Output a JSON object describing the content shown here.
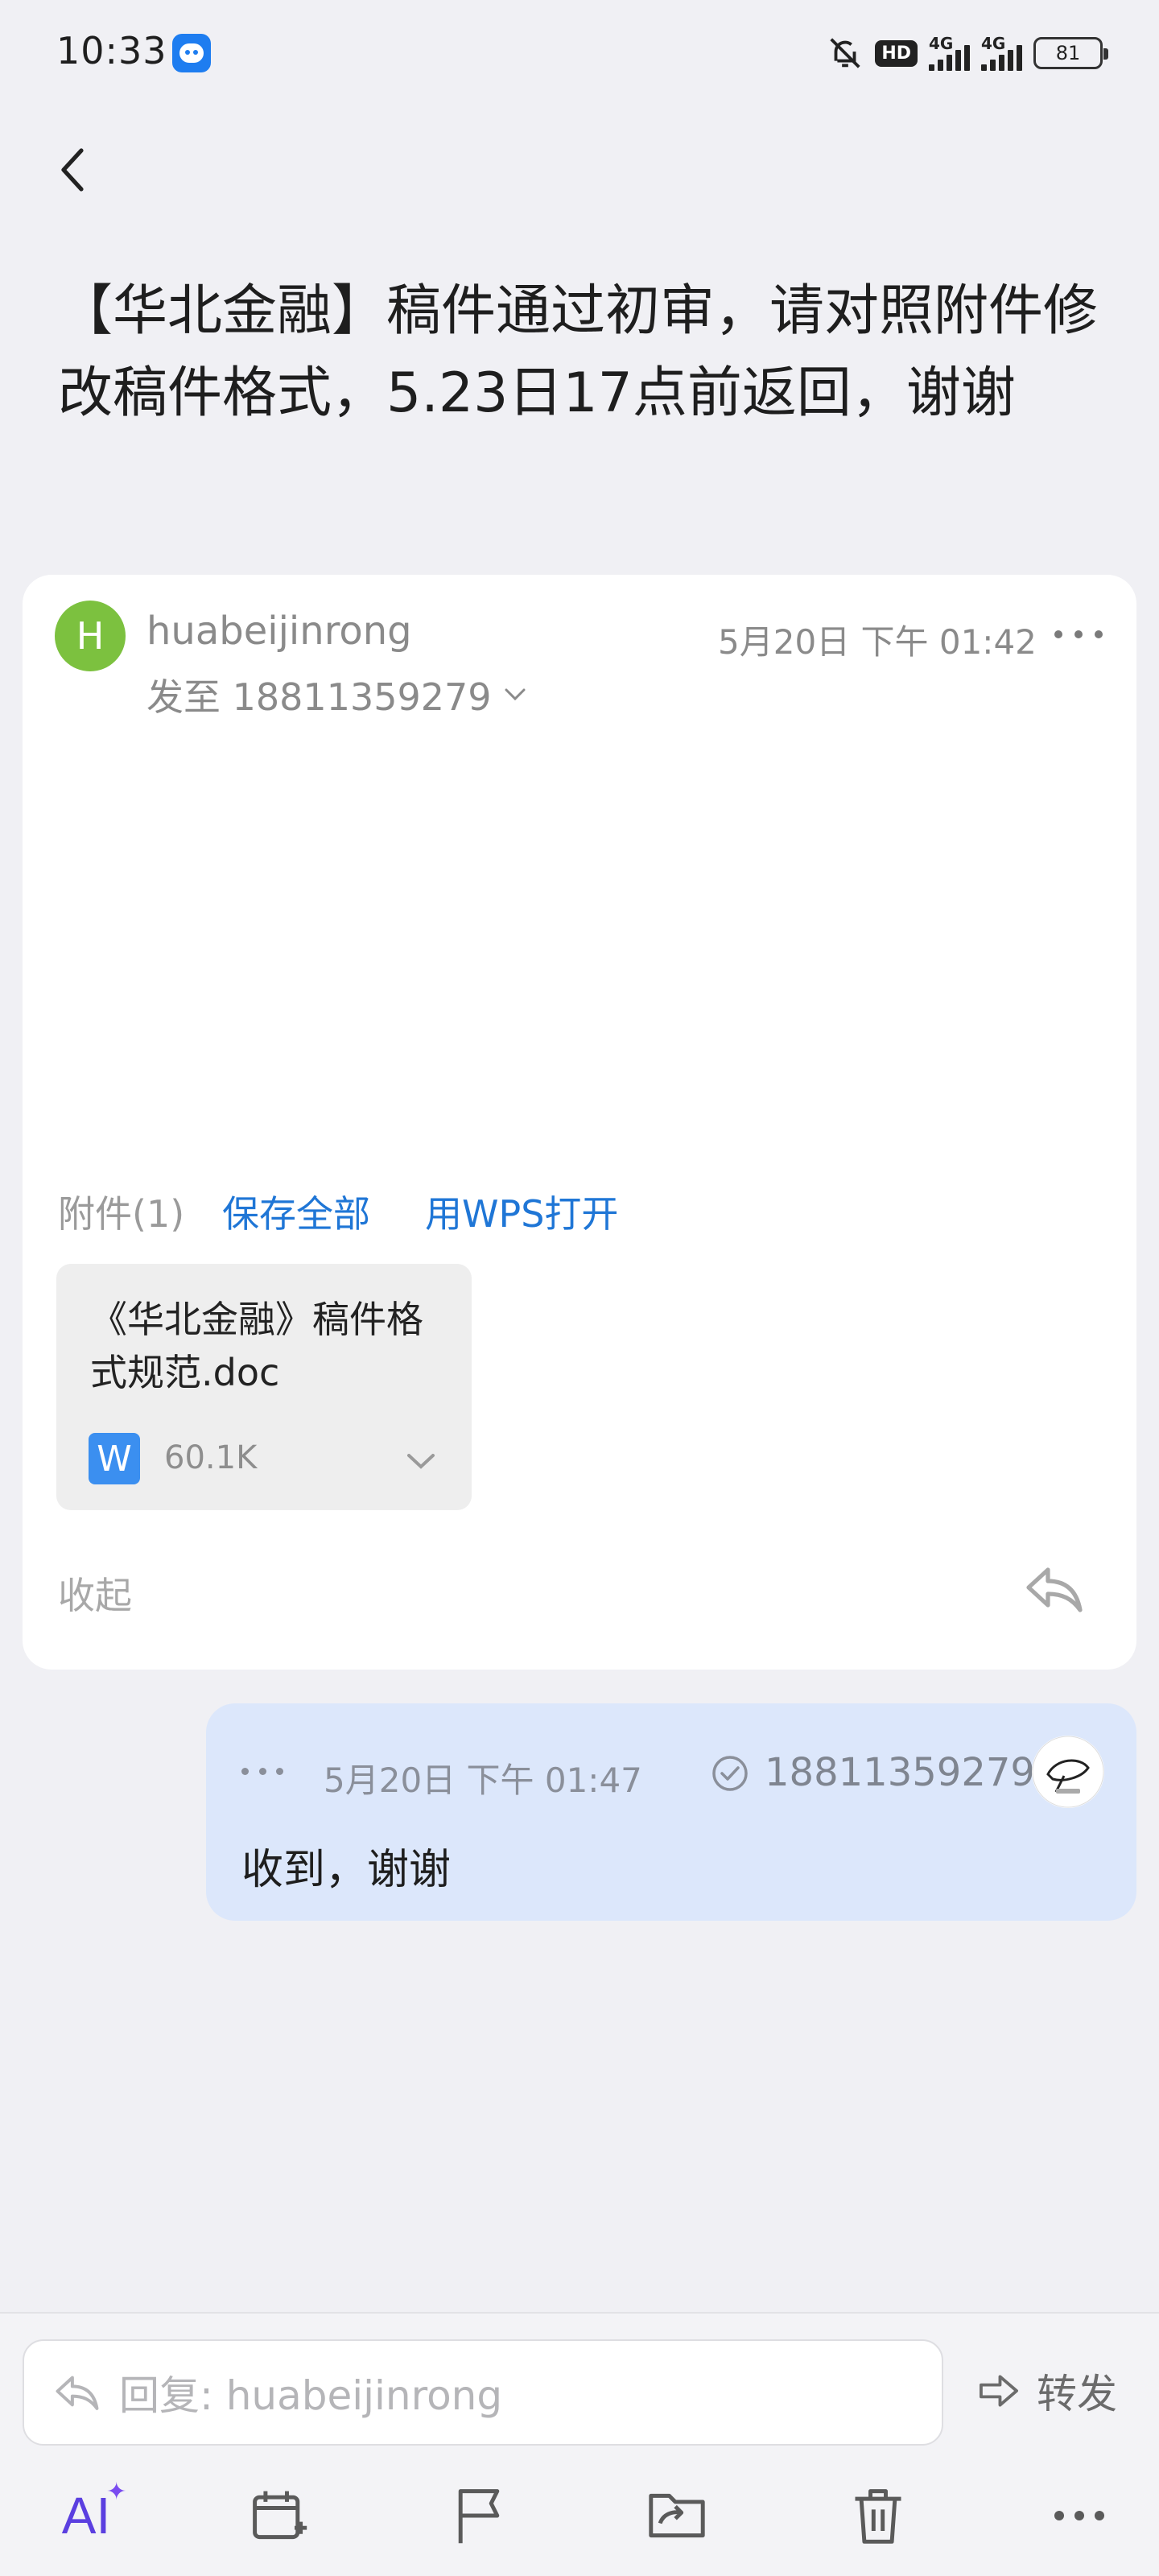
{
  "status_bar": {
    "time": "10:33",
    "hd": "HD",
    "net1": "4G",
    "net2": "4G",
    "battery": "81"
  },
  "email": {
    "subject": "【华北金融】稿件通过初审，请对照附件修改稿件格式，5.23日17点前返回，谢谢",
    "sender": {
      "initial": "H",
      "name": "huabeijinrong",
      "avatar_color": "#7cc13f"
    },
    "recipient_line": "发至 18811359279",
    "date": "5月20日 下午 01:42",
    "attachments": {
      "label": "附件(1)",
      "save_all": "保存全部",
      "open_wps": "用WPS打开",
      "items": [
        {
          "name": "《华北金融》稿件格式规范.doc",
          "size": "60.1K",
          "type_icon": "W"
        }
      ]
    },
    "collapse_label": "收起"
  },
  "reply": {
    "date": "5月20日 下午 01:47",
    "from": "18811359279",
    "text": "收到，谢谢",
    "bubble_color": "#dce7fb"
  },
  "bottom_bar": {
    "reply_placeholder": "回复: huabeijinrong",
    "forward_label": "转发",
    "ai_label": "AI",
    "ai_spark": "✦"
  },
  "colors": {
    "link": "#1f76d6",
    "background": "#f0f0f4",
    "ai": "#5b3fe0"
  }
}
